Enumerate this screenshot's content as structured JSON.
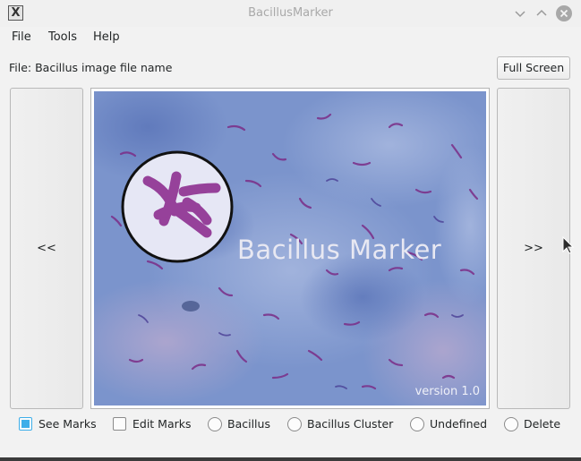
{
  "window": {
    "title": "BacillusMarker",
    "icon": "x-app-icon"
  },
  "menu": {
    "items": [
      "File",
      "Tools",
      "Help"
    ]
  },
  "file": {
    "label": "File:  Bacillus image file name"
  },
  "toolbar": {
    "fullscreen_label": "Full Screen"
  },
  "nav": {
    "prev_label": "<<",
    "next_label": ">>"
  },
  "splash": {
    "title": "Bacillus Marker",
    "version": "version 1.0"
  },
  "options": {
    "see_marks": {
      "label": "See Marks",
      "checked": true
    },
    "edit_marks": {
      "label": "Edit Marks",
      "checked": false
    },
    "radios": [
      "Bacillus",
      "Bacillus Cluster",
      "Undefined",
      "Delete"
    ]
  },
  "colors": {
    "accent": "#3daee9",
    "stain_blue": "#7e97cf",
    "bacillus_purple": "#7b2d87"
  }
}
